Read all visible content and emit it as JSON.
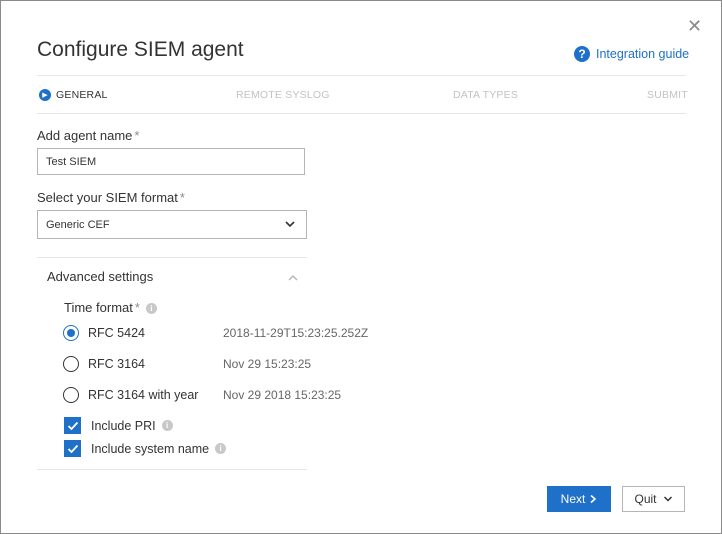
{
  "dialog": {
    "title": "Configure SIEM agent",
    "integration_guide": "Integration guide"
  },
  "steps": [
    {
      "label": "GENERAL",
      "active": true
    },
    {
      "label": "REMOTE SYSLOG",
      "active": false
    },
    {
      "label": "DATA TYPES",
      "active": false
    },
    {
      "label": "SUBMIT",
      "active": false
    }
  ],
  "form": {
    "agent_name_label": "Add agent name",
    "agent_name_value": "Test SIEM",
    "siem_format_label": "Select your SIEM format",
    "siem_format_value": "Generic CEF",
    "required_marker": "*"
  },
  "advanced": {
    "title": "Advanced settings",
    "time_format_label": "Time format",
    "time_formats": [
      {
        "label": "RFC 5424",
        "example": "2018-11-29T15:23:25.252Z",
        "selected": true
      },
      {
        "label": "RFC 3164",
        "example": "Nov 29 15:23:25",
        "selected": false
      },
      {
        "label": "RFC 3164 with year",
        "example": "Nov 29 2018 15:23:25",
        "selected": false
      }
    ],
    "include_pri": "Include PRI",
    "include_pri_checked": true,
    "include_system_name": "Include system name",
    "include_system_name_checked": true
  },
  "buttons": {
    "next": "Next",
    "quit": "Quit"
  },
  "icons": {
    "close": "close-icon",
    "help": "question-circle-icon",
    "step_current": "play-circle-icon",
    "dropdown": "chevron-down-icon",
    "collapse": "chevron-up-icon",
    "info": "info-icon",
    "check": "checkmark-icon"
  },
  "colors": {
    "accent": "#1e70c8",
    "inactive_step": "#c2c2c2"
  }
}
